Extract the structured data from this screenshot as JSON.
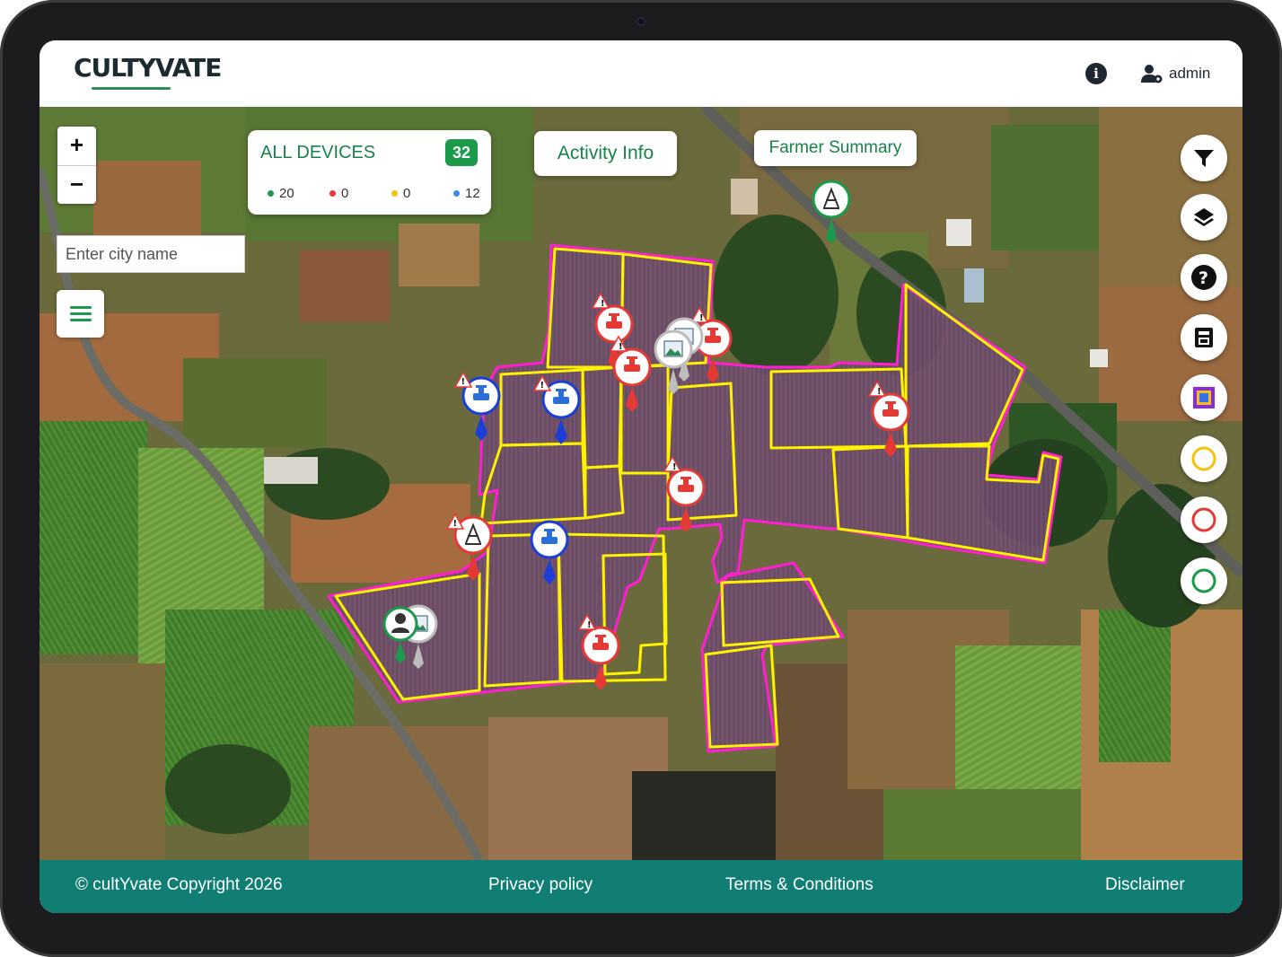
{
  "brand": {
    "logo_text": "CULTYVATE",
    "accent": "#1a9a4a"
  },
  "header": {
    "info_icon": "info-icon",
    "user_label": "admin"
  },
  "map": {
    "zoom_in_label": "+",
    "zoom_out_label": "−",
    "city_search": {
      "placeholder": "Enter city name",
      "value": ""
    }
  },
  "devices_card": {
    "title": "ALL DEVICES",
    "total": "32",
    "stats": [
      {
        "value": "20",
        "color": "#1a9a4a"
      },
      {
        "value": "0",
        "color": "#e53935"
      },
      {
        "value": "0",
        "color": "#f4c20d"
      },
      {
        "value": "12",
        "color": "#3b8ee8"
      }
    ]
  },
  "buttons": {
    "activity_info": "Activity Info",
    "farmer_summary": "Farmer Summary"
  },
  "right_tools": [
    "filter-icon",
    "layers-icon",
    "help-icon",
    "report-icon",
    "draw-polygon-icon",
    "yellow-circle-icon",
    "red-circle-icon",
    "green-circle-icon"
  ],
  "colors": {
    "field_outline_outer": "#ff1fd0",
    "field_outline_inner": "#fff200",
    "alert": "#e53935",
    "device_blue": "#1b3fd6",
    "footer": "#117e73"
  },
  "footer": {
    "copyright": "© cultYvate Copyright 2026",
    "privacy": "Privacy policy",
    "terms": "Terms & Conditions",
    "disclaimer": "Disclaimer"
  }
}
